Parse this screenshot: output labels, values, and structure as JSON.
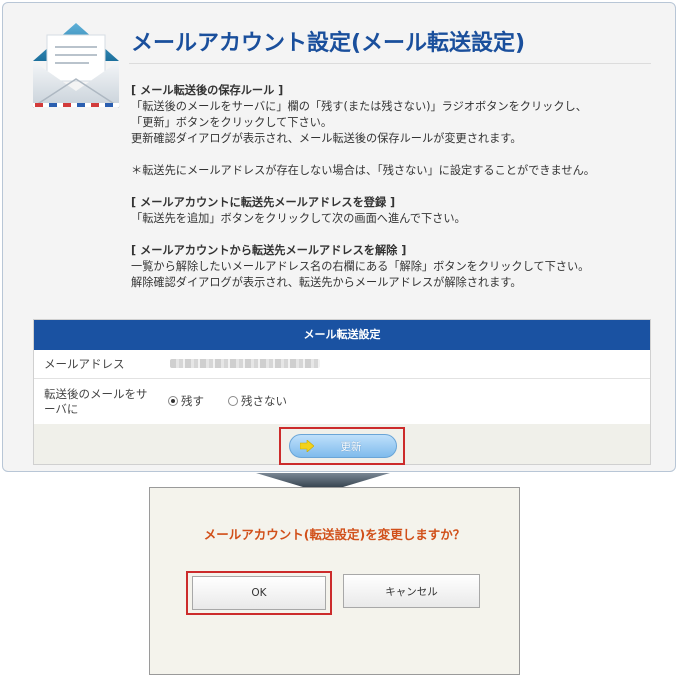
{
  "page": {
    "title": "メールアカウント設定(メール転送設定)"
  },
  "instructions": {
    "rule_heading": "[ メール転送後の保存ルール ]",
    "rule_line1": "「転送後のメールをサーバに」欄の「残す(または残さない)」ラジオボタンをクリックし、",
    "rule_line2": "「更新」ボタンをクリックして下さい。",
    "rule_line3": "更新確認ダイアログが表示され、メール転送後の保存ルールが変更されます。",
    "note": "＊転送先にメールアドレスが存在しない場合は、「残さない」に設定することができません。",
    "register_heading": "[ メールアカウントに転送先メールアドレスを登録 ]",
    "register_line1": "「転送先を追加」ボタンをクリックして次の画面へ進んで下さい。",
    "remove_heading": "[ メールアカウントから転送先メールアドレスを解除 ]",
    "remove_line1": "一覧から解除したいメールアドレス名の右欄にある「解除」ボタンをクリックして下さい。",
    "remove_line2": "解除確認ダイアログが表示され、転送先からメールアドレスが解除されます。"
  },
  "form": {
    "header": "メール転送設定",
    "email_label": "メールアドレス",
    "keep_label": "転送後のメールをサーバに",
    "radio_keep": "残す",
    "radio_discard": "残さない",
    "selected": "keep",
    "update_button": "更新"
  },
  "dialog": {
    "message": "メールアカウント(転送設定)を変更しますか？",
    "ok_button": "OK",
    "cancel_button": "キャンセル"
  },
  "colors": {
    "title": "#1a4f9c",
    "form_header": "#1a52a2",
    "highlight": "#cc2b2b",
    "dialog_message": "#d1501a"
  },
  "icons": [
    "envelope-icon",
    "arrow-right-icon",
    "down-arrow-icon"
  ]
}
